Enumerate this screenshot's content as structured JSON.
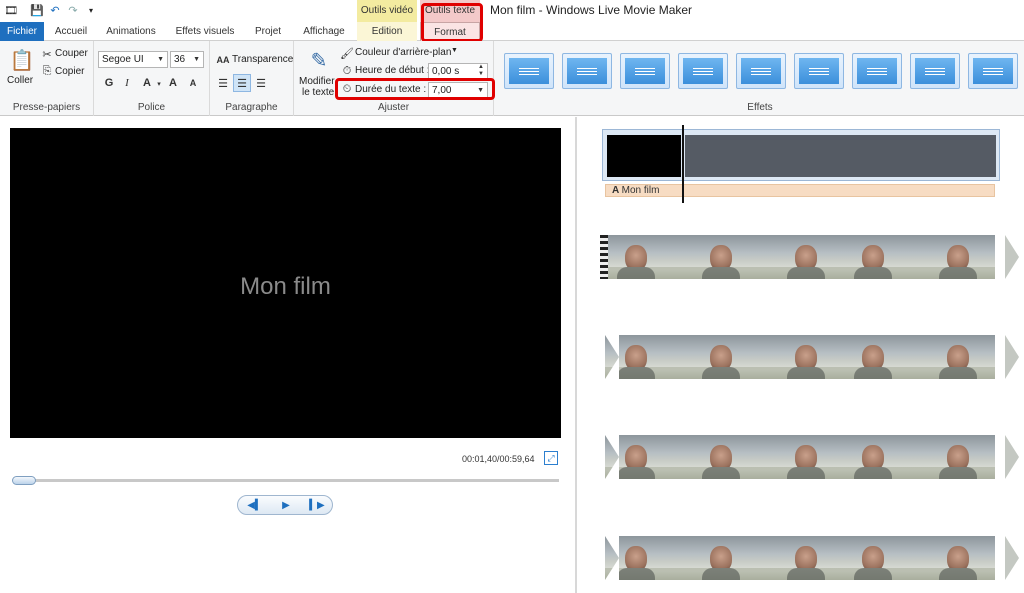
{
  "window": {
    "title": "Mon film - Windows Live Movie Maker"
  },
  "context_groups": {
    "video": "Outils vidéo",
    "text": "Outils texte"
  },
  "tabs": {
    "fichier": "Fichier",
    "accueil": "Accueil",
    "animations": "Animations",
    "effets_visuels": "Effets visuels",
    "projet": "Projet",
    "affichage": "Affichage",
    "edition": "Edition",
    "format": "Format"
  },
  "ribbon": {
    "clipboard": {
      "paste": "Coller",
      "cut": "Couper",
      "copy": "Copier",
      "label": "Presse-papiers"
    },
    "font": {
      "family": "Segoe UI",
      "size": "36",
      "bold": "G",
      "italic": "I",
      "color": "A",
      "grow": "A",
      "shrink": "A",
      "label": "Police"
    },
    "paragraph": {
      "transparency": "Transparence",
      "label": "Paragraphe"
    },
    "adjust": {
      "edit_text_line1": "Modifier",
      "edit_text_line2": "le texte",
      "background_color": "Couleur d'arrière-plan",
      "start_time_label": "Heure de début :",
      "start_time_value": "0,00 s",
      "duration_label": "Durée du texte :",
      "duration_value": "7,00",
      "label": "Ajuster"
    },
    "effects": {
      "label": "Effets",
      "count": 9
    }
  },
  "preview": {
    "overlay_text": "Mon film",
    "timecode": "00:01,40/00:59,64",
    "progress": 0.0235
  },
  "storyboard": {
    "title_clip_caption": "Mon film"
  },
  "colors": {
    "accent": "#1e6fbf",
    "highlight": "#e00000",
    "video_tools": "#f3eba0",
    "text_tools": "#f3c9c9"
  }
}
